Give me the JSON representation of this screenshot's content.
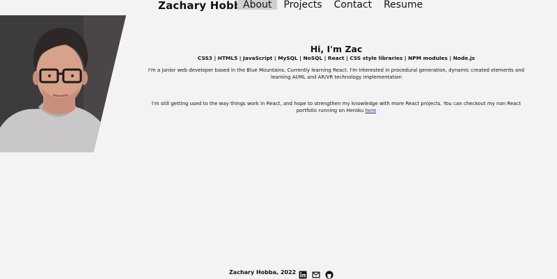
{
  "header": {
    "brand": "Zachary Hobba",
    "nav": [
      "About",
      "Projects",
      "Contact",
      "Resume"
    ]
  },
  "hero": {
    "title": "Hi, I'm Zac",
    "skills": "CSS3 | HTML5 | JavaScript | MySQL | NoSQL | React | CSS style libraries | NPM modules | Node.js",
    "intro": "I'm a junior web developer based in the Blue Mountains. Currently learning React. I'm Interested in procedural generation, dynamic created elements and learning AI/ML and AR/VR technology implementation",
    "outro_text": "I'm still getting used to the way things work in React, and hope to strengthen my knowledge with more React projects. You can checkout my non React portfolio running on Heroku",
    "outro_link": "here"
  },
  "footer": {
    "copyright": "Zachary Hobba, 2022",
    "icons": [
      "linkedin-icon",
      "email-icon",
      "github-icon"
    ]
  },
  "colors": {
    "background": "#f4f3f3",
    "nav_active": "#cfcfcf",
    "link": "#3a1fa8"
  }
}
